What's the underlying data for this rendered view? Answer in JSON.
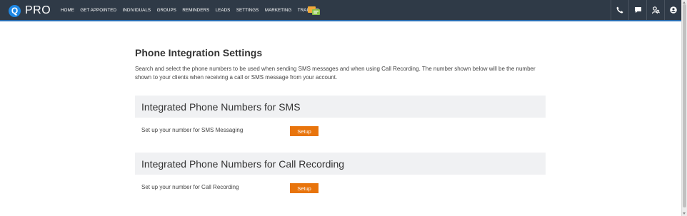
{
  "brand": {
    "logo_letter": "Q",
    "logo_text": "PRO"
  },
  "nav": {
    "items": [
      "HOME",
      "GET APPOINTED",
      "INDIVIDUALS",
      "GROUPS",
      "REMINDERS",
      "LEADS",
      "SETTINGS",
      "MARKETING",
      "TRAINING"
    ],
    "right_icons": [
      "phone-icon",
      "chat-icon",
      "user-search-icon",
      "account-icon"
    ]
  },
  "page": {
    "title": "Phone Integration Settings",
    "description": "Search and select the phone numbers to be used when sending SMS messages and when using Call Recording. The number shown below will be the number shown to your clients when receiving a call or SMS message from your account."
  },
  "sections": {
    "sms": {
      "header": "Integrated Phone Numbers for SMS",
      "row_label": "Set up your number for SMS Messaging",
      "button": "Setup"
    },
    "call_recording": {
      "header": "Integrated Phone Numbers for Call Recording",
      "row_label": "Set up your number for Call Recording",
      "button": "Setup"
    }
  },
  "colors": {
    "topbar": "#2f3a47",
    "accent_line": "#2a6fb4",
    "button": "#e8740c",
    "section_bg": "#f0f1f3"
  }
}
